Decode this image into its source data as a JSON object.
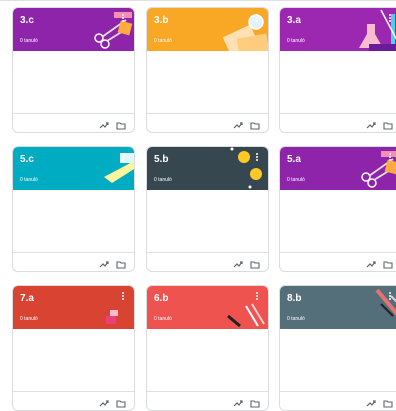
{
  "classes": [
    {
      "title": "3.c",
      "subtitle": "0 tanuló",
      "color": "#8e24aa",
      "theme": "scissors"
    },
    {
      "title": "3.b",
      "subtitle": "0 tanuló",
      "color": "#f9a825",
      "theme": "paper"
    },
    {
      "title": "3.a",
      "subtitle": "0 tanuló",
      "color": "#9c27b0",
      "theme": "lab"
    },
    {
      "title": "5.c",
      "subtitle": "0 tanuló",
      "color": "#00acc1",
      "theme": "brush"
    },
    {
      "title": "5.b",
      "subtitle": "0 tanuló",
      "color": "#37474f",
      "theme": "coins"
    },
    {
      "title": "5.a",
      "subtitle": "0 tanuló",
      "color": "#8e24aa",
      "theme": "scissors"
    },
    {
      "title": "7.a",
      "subtitle": "0 tanuló",
      "color": "#d84332",
      "theme": "gift"
    },
    {
      "title": "6.b",
      "subtitle": "0 tanuló",
      "color": "#ef5350",
      "theme": "pencils"
    },
    {
      "title": "8.b",
      "subtitle": "0 tanuló",
      "color": "#546e7a",
      "theme": "tools"
    }
  ],
  "icons": {
    "menu": "more-vert-icon",
    "trend": "trending-up-icon",
    "folder": "folder-icon"
  }
}
